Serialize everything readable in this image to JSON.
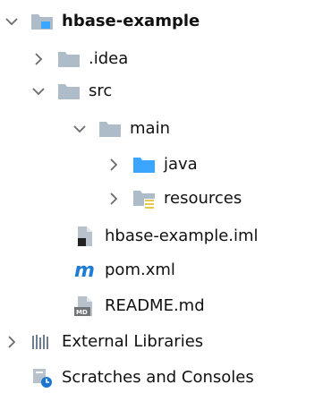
{
  "tree": {
    "root": {
      "label": "hbase-example",
      "expanded": true
    },
    "idea": {
      "label": ".idea",
      "expanded": false
    },
    "src": {
      "label": "src",
      "expanded": true
    },
    "main": {
      "label": "main",
      "expanded": true
    },
    "java": {
      "label": "java",
      "expanded": false
    },
    "resources": {
      "label": "resources",
      "expanded": false
    },
    "iml": {
      "label": "hbase-example.iml"
    },
    "pom": {
      "label": "pom.xml"
    },
    "readme": {
      "label": "README.md"
    },
    "external": {
      "label": "External Libraries",
      "expanded": false
    },
    "scratches": {
      "label": "Scratches and Consoles"
    }
  },
  "colors": {
    "folder": "#aebbc8",
    "module_folder": "#7b9bb7",
    "java_folder": "#3aa6ff",
    "resources_badge": "#e6c84e",
    "maven": "#1e7cd6",
    "markdown": "#8a8f95",
    "scratches_badge": "#1b74d1",
    "lib_bars": "#6e7e8f",
    "text": "#111111",
    "arrow": "#6b6b6b"
  }
}
